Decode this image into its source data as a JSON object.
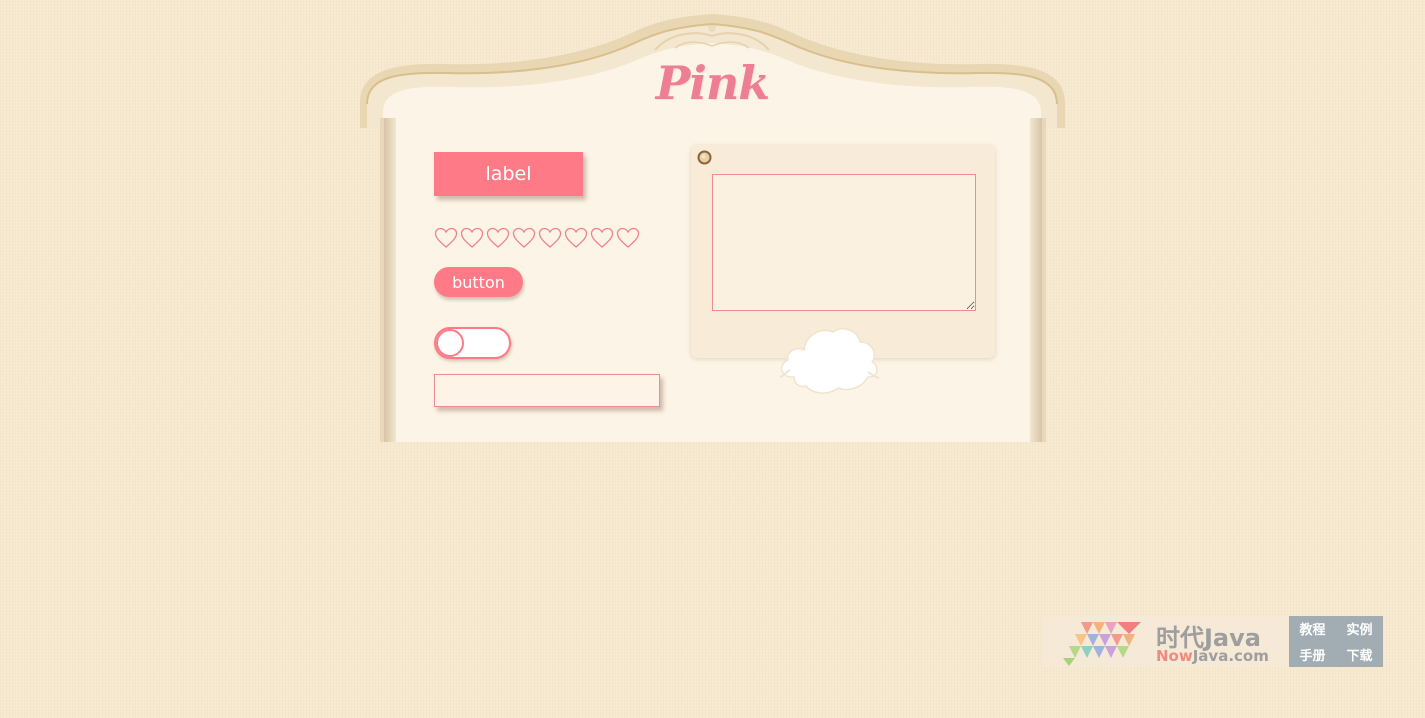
{
  "header": {
    "title": "Pink"
  },
  "controls": {
    "label_text": "label",
    "rating": {
      "count": 8,
      "filled": 0
    },
    "button_label": "button",
    "toggle": {
      "on": false
    },
    "input": {
      "value": "",
      "placeholder": ""
    }
  },
  "card": {
    "textarea": {
      "value": "",
      "placeholder": ""
    }
  },
  "watermark": {
    "title": "时代Java",
    "subtitle_accent": "Now",
    "subtitle_rest": "Java.com",
    "links": [
      "教程",
      "实例",
      "手册",
      "下载"
    ]
  },
  "colors": {
    "accent": "#fe7a86",
    "title": "#ee7e93",
    "panel": "#fcf4e6",
    "background": "#f6e9cf"
  },
  "icons": {
    "rating_item": "heart-outline-icon",
    "card_pin": "pin-icon",
    "decoration": "cloud-icon"
  }
}
